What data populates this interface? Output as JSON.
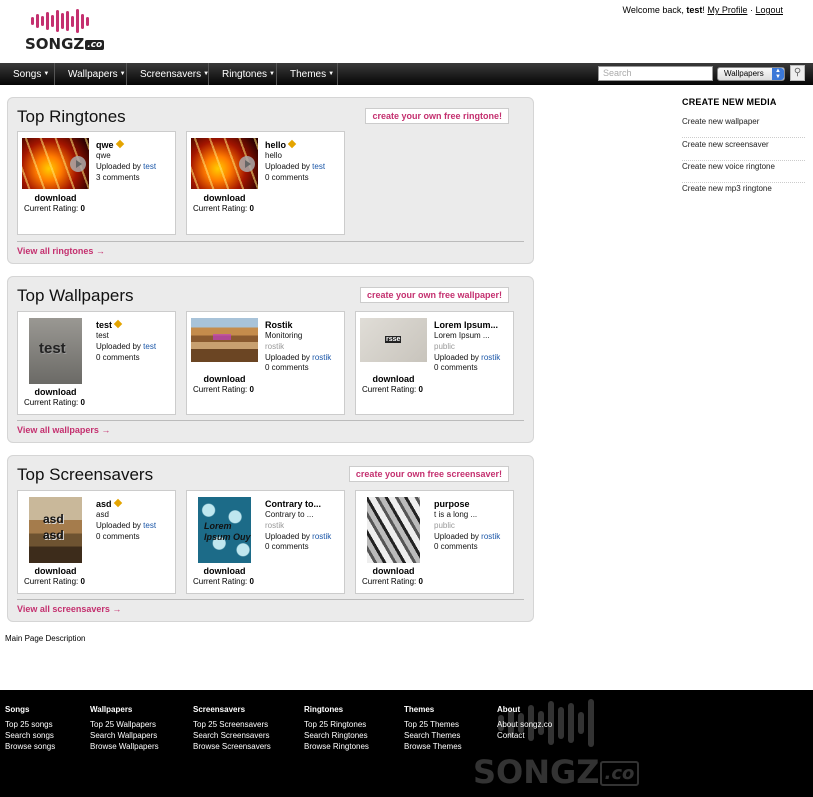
{
  "brand": {
    "name": "SONGZ",
    "suffix": ".co"
  },
  "userbar": {
    "welcome": "Welcome back, ",
    "username": "test",
    "profile_label": "My Profile",
    "separator": "·",
    "logout_label": "Logout"
  },
  "nav": {
    "items": [
      "Songs",
      "Wallpapers",
      "Screensavers",
      "Ringtones",
      "Themes"
    ]
  },
  "search": {
    "placeholder": "Search",
    "select_value": "Wallpapers"
  },
  "ringtones": {
    "title": "Top Ringtones",
    "create_label": "create your own free ringtone!",
    "view_all": "View all ringtones →",
    "items": [
      {
        "name": "qwe",
        "desc": "qwe",
        "uploaded_prefix": "Uploaded by ",
        "uploader": "test",
        "comments": "3 comments",
        "download": "download",
        "rating_label": "Current Rating: ",
        "rating": "0"
      },
      {
        "name": "hello",
        "desc": "hello",
        "uploaded_prefix": "Uploaded by ",
        "uploader": "test",
        "comments": "0 comments",
        "download": "download",
        "rating_label": "Current Rating: ",
        "rating": "0"
      }
    ]
  },
  "wallpapers": {
    "title": "Top Wallpapers",
    "create_label": "create your own free wallpaper!",
    "view_all": "View all wallpapers →",
    "items": [
      {
        "name": "test",
        "desc": "test",
        "thumb_text": "test",
        "uploaded_prefix": "Uploaded by ",
        "uploader": "test",
        "comments": "0 comments",
        "download": "download",
        "rating_label": "Current Rating: ",
        "rating": "0"
      },
      {
        "name": "Rostik",
        "desc": "Monitoring",
        "visibility": "rostik",
        "uploaded_prefix": "Uploaded by ",
        "uploader": "rostik",
        "comments": "0 comments",
        "download": "download",
        "rating_label": "Current Rating: ",
        "rating": "0"
      },
      {
        "name": "Lorem Ipsum...",
        "desc": "Lorem Ipsum ...",
        "thumb_text": "rsse",
        "visibility": "public",
        "uploaded_prefix": "Uploaded by ",
        "uploader": "rostik",
        "comments": "0 comments",
        "download": "download",
        "rating_label": "Current Rating: ",
        "rating": "0"
      }
    ]
  },
  "screensavers": {
    "title": "Top Screensavers",
    "create_label": "create your own free screensaver!",
    "view_all": "View all screensavers →",
    "items": [
      {
        "name": "asd",
        "desc": "asd",
        "thumb_text": "asd asd",
        "uploaded_prefix": "Uploaded by ",
        "uploader": "test",
        "comments": "0 comments",
        "download": "download",
        "rating_label": "Current Rating: ",
        "rating": "0"
      },
      {
        "name": "Contrary to...",
        "desc": "Contrary to ...",
        "thumb_text": "Lorem Ipsum Ouy",
        "visibility": "rostik",
        "uploaded_prefix": "Uploaded by ",
        "uploader": "rostik",
        "comments": "0 comments",
        "download": "download",
        "rating_label": "Current Rating: ",
        "rating": "0"
      },
      {
        "name": "purpose",
        "desc": "t is a long ...",
        "visibility": "public",
        "uploaded_prefix": "Uploaded by ",
        "uploader": "rostik",
        "comments": "0 comments",
        "download": "download",
        "rating_label": "Current Rating: ",
        "rating": "0"
      }
    ]
  },
  "sidebar": {
    "title": "CREATE NEW MEDIA",
    "links": [
      "Create new wallpaper",
      "Create new screensaver",
      "Create new voice ringtone",
      "Create new mp3 ringtone"
    ]
  },
  "main_description": "Main Page Description",
  "footer": {
    "columns": [
      {
        "title": "Songs",
        "links": [
          "Top 25 songs",
          "Search songs",
          "Browse songs"
        ]
      },
      {
        "title": "Wallpapers",
        "links": [
          "Top 25 Wallpapers",
          "Search Wallpapers",
          "Browse Wallpapers"
        ]
      },
      {
        "title": "Screensavers",
        "links": [
          "Top 25 Screensavers",
          "Search Screensavers",
          "Browse Screensavers"
        ]
      },
      {
        "title": "Ringtones",
        "links": [
          "Top 25 Ringtones",
          "Search Ringtones",
          "Browse Ringtones"
        ]
      },
      {
        "title": "Themes",
        "links": [
          "Top 25 Themes",
          "Search Themes",
          "Browse Themes"
        ]
      },
      {
        "title": "About",
        "links": [
          "About songz.co",
          "Contact"
        ]
      }
    ]
  },
  "colors": {
    "accent": "#c4306f",
    "link": "#1a56a8",
    "panel_bg": "#ebebeb",
    "nav_bg": "#111111"
  }
}
